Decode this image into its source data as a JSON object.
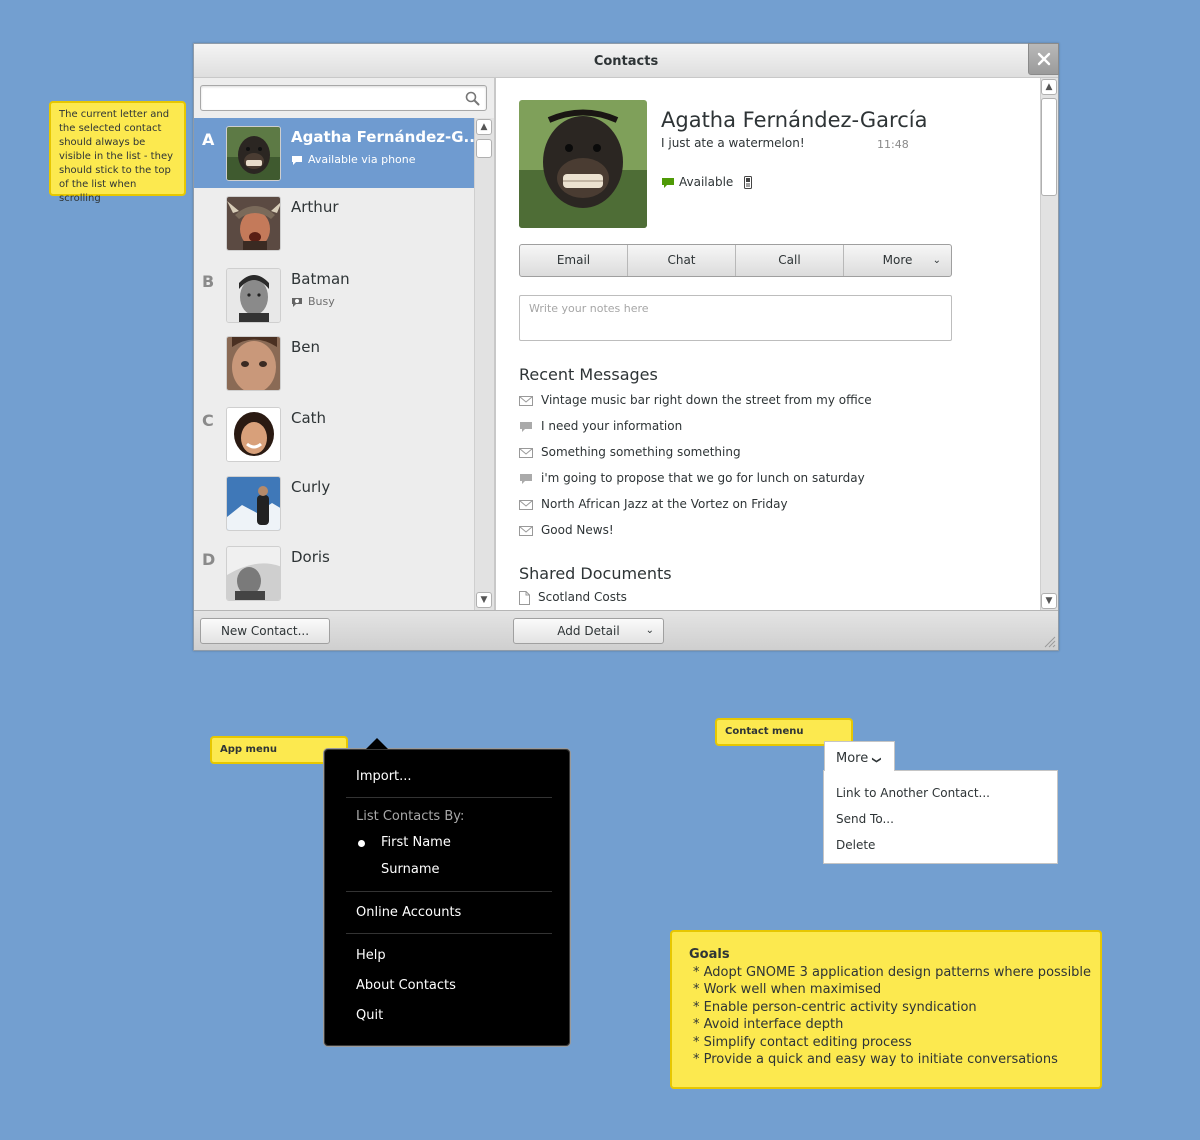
{
  "window": {
    "title": "Contacts",
    "close_icon": "close-icon"
  },
  "search": {
    "placeholder": "",
    "value": ""
  },
  "contacts": [
    {
      "letter": "A",
      "name": "Agatha Fernández-G...",
      "status": "Available via phone",
      "status_icon": "speech-bubble-icon",
      "selected": true
    },
    {
      "letter": "",
      "name": "Arthur",
      "status": ""
    },
    {
      "letter": "B",
      "name": "Batman",
      "status": "Busy",
      "status_icon": "busy-icon"
    },
    {
      "letter": "",
      "name": "Ben",
      "status": ""
    },
    {
      "letter": "C",
      "name": "Cath",
      "status": ""
    },
    {
      "letter": "",
      "name": "Curly",
      "status": ""
    },
    {
      "letter": "D",
      "name": "Doris",
      "status": ""
    }
  ],
  "profile": {
    "name": "Agatha Fernández-García",
    "message": "I just ate a watermelon!",
    "time": "11:48",
    "presence": "Available"
  },
  "actions": {
    "email": "Email",
    "chat": "Chat",
    "call": "Call",
    "more": "More"
  },
  "notes": {
    "placeholder": "Write your notes here"
  },
  "recent_messages": {
    "title": "Recent Messages",
    "items": [
      {
        "icon": "envelope-icon",
        "text": "Vintage music bar right down the street from my office"
      },
      {
        "icon": "speech-bubble-icon",
        "text": "I need your information"
      },
      {
        "icon": "envelope-icon",
        "text": "Something something something"
      },
      {
        "icon": "speech-bubble-icon",
        "text": "i'm going to propose that we go for lunch on saturday"
      },
      {
        "icon": "envelope-icon",
        "text": "North African Jazz at the Vortez on Friday"
      },
      {
        "icon": "envelope-icon",
        "text": "Good News!"
      }
    ]
  },
  "shared_documents": {
    "title": "Shared Documents",
    "items": [
      {
        "icon": "document-icon",
        "text": "Scotland Costs"
      }
    ]
  },
  "toolbar": {
    "new_contact": "New Contact...",
    "add_detail": "Add Detail"
  },
  "annotations": {
    "sticky_letter": "The current letter and the selected contact should always be visible in the list - they should stick to the top of the list when scrolling",
    "app_menu_label": "App menu",
    "contact_menu_label": "Contact menu"
  },
  "app_menu": {
    "import": "Import...",
    "list_by_header": "List Contacts By:",
    "first_name": "First Name",
    "surname": "Surname",
    "selected_sort": "First Name",
    "online_accounts": "Online Accounts",
    "help": "Help",
    "about": "About Contacts",
    "quit": "Quit"
  },
  "contact_menu": {
    "more": "More",
    "link": "Link to Another Contact...",
    "send_to": "Send To...",
    "delete": "Delete"
  },
  "goals": {
    "title": "Goals",
    "items": [
      " * Adopt GNOME 3 application design patterns where possible",
      " * Work well when maximised",
      " * Enable person-centric activity syndication",
      " * Avoid interface depth",
      " * Simplify contact editing process",
      " * Provide a quick and easy way to initiate conversations"
    ]
  },
  "colors": {
    "desktop": "#739fd0",
    "selection": "#6f9bd0",
    "note_yellow": "#fce94f",
    "available_green": "#4e9a06"
  }
}
